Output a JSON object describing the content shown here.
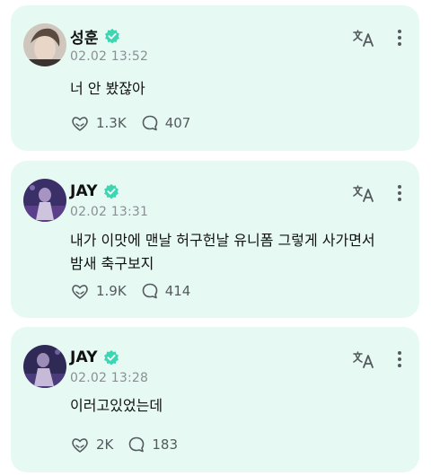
{
  "posts": [
    {
      "author": "성훈",
      "timestamp": "02.02 13:52",
      "text": "너 안 봤잖아",
      "likes": "1.3K",
      "comments": "407",
      "avatar_color": "#8d7a6a"
    },
    {
      "author": "JAY",
      "timestamp": "02.02 13:31",
      "text": "내가 이맛에 맨날 허구헌날 유니폼 그렇게 사가면서\n밤새 축구보지",
      "likes": "1.9K",
      "comments": "414",
      "avatar_color": "#3a2f66"
    },
    {
      "author": "JAY",
      "timestamp": "02.02 13:28",
      "text": "이러고있었는데",
      "likes": "2K",
      "comments": "183",
      "avatar_color": "#2e2a55"
    }
  ],
  "icons": {
    "verified": "verified-badge-icon",
    "translate": "translate-icon",
    "more": "more-vertical-icon",
    "like": "heart-hands-icon",
    "comment": "comment-bubble-icon"
  },
  "colors": {
    "card_background": "#e6faf3",
    "verified_badge": "#3dd6b2",
    "secondary_text": "#8a8f93"
  }
}
